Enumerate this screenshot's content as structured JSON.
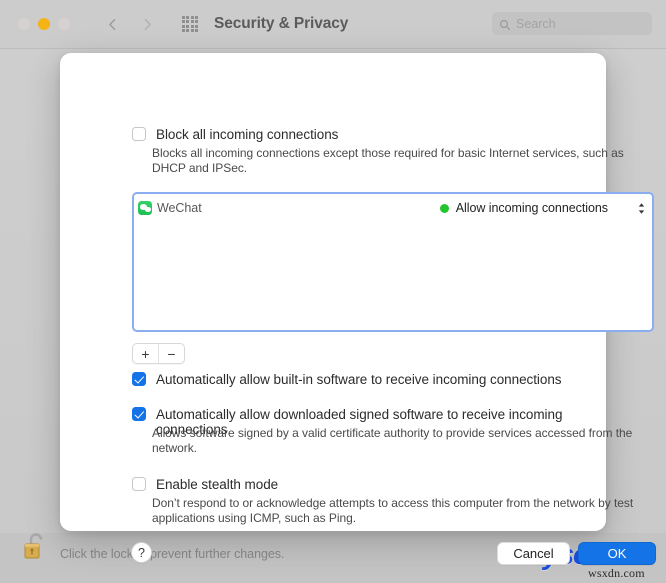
{
  "window": {
    "title": "Security & Privacy",
    "traffic_lights": [
      "close",
      "minimize",
      "zoom"
    ],
    "nav_back_icon": "chevron-left-icon",
    "nav_forward_icon": "chevron-right-icon",
    "grid_icon": "show-all-preferences-grid-icon",
    "accent_color": "#1473e6"
  },
  "search": {
    "placeholder": "Search",
    "value": "",
    "icon": "search-icon"
  },
  "sheet": {
    "block_all": {
      "label": "Block all incoming connections",
      "checked": false,
      "description": "Blocks all incoming connections except those required for basic Internet services, such as DHCP and IPSec."
    },
    "app_list": {
      "rows": [
        {
          "app_name": "WeChat",
          "icon": "wechat-app-icon",
          "status_label": "Allow incoming connections",
          "status_color": "#23c52e",
          "stepper_icon": "chevron-up-down-icon"
        }
      ]
    },
    "list_controls": {
      "add_label": "+",
      "remove_label": "−"
    },
    "auto_builtin": {
      "label": "Automatically allow built-in software to receive incoming connections",
      "checked": true
    },
    "auto_signed": {
      "label": "Automatically allow downloaded signed software to receive incoming connections",
      "checked": true,
      "description": "Allows software signed by a valid certificate authority to provide services accessed from the network."
    },
    "stealth": {
      "label": "Enable stealth mode",
      "checked": false,
      "description": "Don’t respond to or acknowledge attempts to access this computer from the network by test applications using ICMP, such as Ping."
    },
    "footer": {
      "help_label": "?",
      "cancel_label": "Cancel",
      "ok_label": "OK"
    }
  },
  "bottom_bar": {
    "lock_icon": "open-padlock-icon",
    "lock_text": "Click the lock to prevent further changes.",
    "help_label": "?"
  },
  "watermark": {
    "brand": "iBoysoft",
    "site": "wsxdn.com"
  }
}
